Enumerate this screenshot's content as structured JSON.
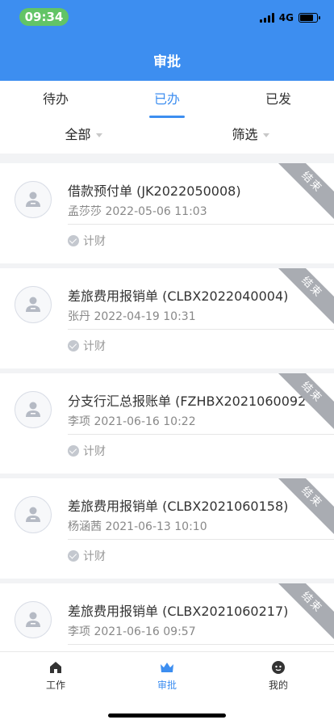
{
  "status_bar": {
    "time": "09:34",
    "network": "4G"
  },
  "header": {
    "title": "审批"
  },
  "tabs": [
    {
      "label": "待办",
      "active": false
    },
    {
      "label": "已办",
      "active": true
    },
    {
      "label": "已发",
      "active": false
    }
  ],
  "filters": {
    "all_label": "全部",
    "filter_label": "筛选"
  },
  "items": [
    {
      "title": "借款预付单 (JK2022050008)",
      "person": "孟莎莎",
      "datetime": "2022-05-06 11:03",
      "node": "计财",
      "status": "结束"
    },
    {
      "title": "差旅费用报销单 (CLBX2022040004)",
      "person": "张丹",
      "datetime": "2022-04-19 10:31",
      "node": "计财",
      "status": "结束"
    },
    {
      "title": "分支行汇总报账单 (FZHBX2021060092",
      "person": "李项",
      "datetime": "2021-06-16 10:22",
      "node": "计财",
      "status": "结束"
    },
    {
      "title": "差旅费用报销单 (CLBX2021060158)",
      "person": "杨涵茜",
      "datetime": "2021-06-13 10:10",
      "node": "计财",
      "status": "结束"
    },
    {
      "title": "差旅费用报销单 (CLBX2021060217)",
      "person": "李项",
      "datetime": "2021-06-16 09:57",
      "node": "",
      "status": "结束"
    }
  ],
  "bottom_nav": [
    {
      "label": "工作",
      "icon": "home-icon",
      "active": false
    },
    {
      "label": "审批",
      "icon": "crown-icon",
      "active": true
    },
    {
      "label": "我的",
      "icon": "face-icon",
      "active": false
    }
  ],
  "colors": {
    "primary": "#3d8ef0",
    "time_pill": "#62c466",
    "ribbon": "#a9acb2"
  }
}
